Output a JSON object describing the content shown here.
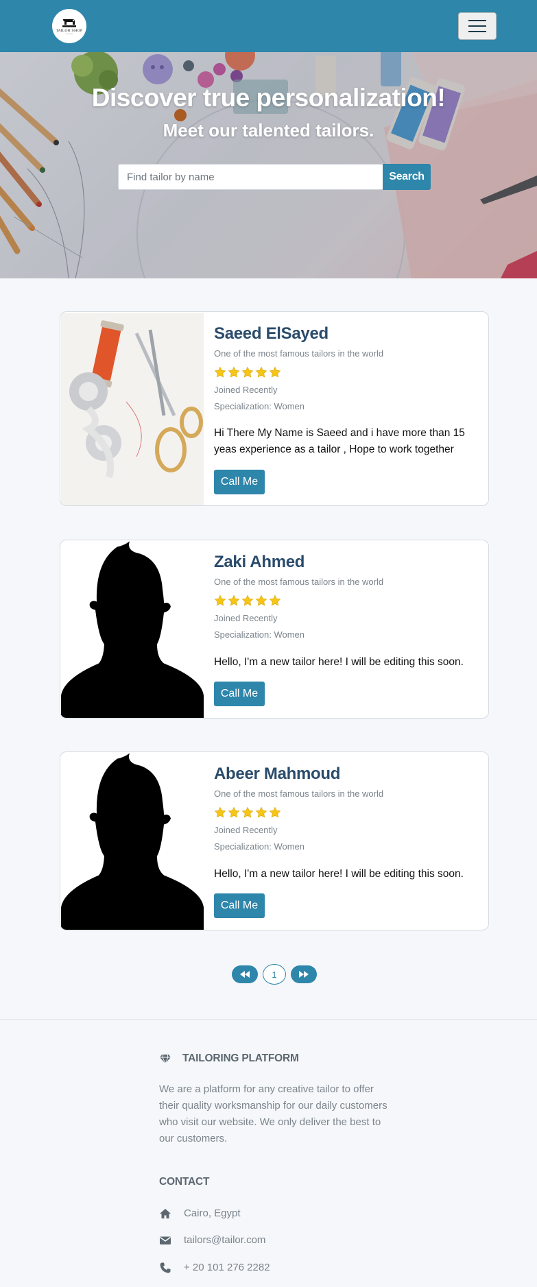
{
  "navbar": {
    "logo_text": "TAILOR SHOP",
    "logo_sub": "──────"
  },
  "hero": {
    "title": "Discover true personalization!",
    "subtitle": "Meet our talented tailors.",
    "search_placeholder": "Find tailor by name",
    "search_button": "Search"
  },
  "tailors": [
    {
      "name": "Saeed ElSayed",
      "tagline": "One of the most famous tailors in the world",
      "rating": 5,
      "joined": "Joined Recently",
      "specialization": "Specialization: Women",
      "bio": "Hi There My Name is Saeed and i have more than 15 yeas experience as a tailor , Hope to work together",
      "button": "Call Me",
      "image": "tailoring-tools-photo"
    },
    {
      "name": "Zaki Ahmed",
      "tagline": "One of the most famous tailors in the world",
      "rating": 5,
      "joined": "Joined Recently",
      "specialization": "Specialization: Women",
      "bio": "Hello, I'm a new tailor here! I will be editing this soon.",
      "button": "Call Me",
      "image": "avatar-silhouette"
    },
    {
      "name": "Abeer Mahmoud",
      "tagline": "One of the most famous tailors in the world",
      "rating": 5,
      "joined": "Joined Recently",
      "specialization": "Specialization: Women",
      "bio": "Hello, I'm a new tailor here! I will be editing this soon.",
      "button": "Call Me",
      "image": "avatar-silhouette"
    }
  ],
  "pagination": {
    "current_page": "1"
  },
  "footer": {
    "about_heading": "TAILORING PLATFORM",
    "about_text": "We are a platform for any creative tailor to offer their quality worksmanship for our daily customers who visit our website. We only deliver the best to our customers.",
    "contact_heading": "CONTACT",
    "address": "Cairo, Egypt",
    "email": "tailors@tailor.com",
    "phone": "+ 20 101 276 2282"
  },
  "colors": {
    "primary": "#2e86ab",
    "star": "#f5c518",
    "heading": "#2a4b6b",
    "muted": "#7b848c"
  }
}
